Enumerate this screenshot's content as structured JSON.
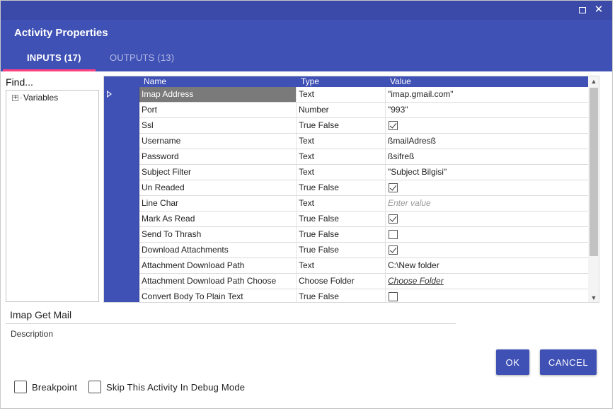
{
  "window": {
    "title": "Activity Properties",
    "maximize_icon": "maximize-icon",
    "close_icon": "close-icon"
  },
  "tabs": [
    {
      "label": "INPUTS (17)",
      "active": true
    },
    {
      "label": "OUTPUTS (13)",
      "active": false
    }
  ],
  "sidebar": {
    "find_label": "Find...",
    "tree": [
      {
        "label": "Variables",
        "expander": "+"
      }
    ]
  },
  "grid": {
    "columns": [
      "Name",
      "Type",
      "Value"
    ],
    "rows": [
      {
        "name": "Imap Address",
        "type": "Text",
        "value": "\"imap.gmail.com\"",
        "kind": "text",
        "active": true
      },
      {
        "name": "Port",
        "type": "Number",
        "value": "\"993\"",
        "kind": "text"
      },
      {
        "name": "Ssl",
        "type": "True False",
        "checked": true,
        "kind": "checkbox"
      },
      {
        "name": "Username",
        "type": "Text",
        "value": "ßmailAdresß",
        "kind": "text"
      },
      {
        "name": "Password",
        "type": "Text",
        "value": "ßsifreß",
        "kind": "text"
      },
      {
        "name": "Subject Filter",
        "type": "Text",
        "value": "\"Subject Bilgisi\"",
        "kind": "text"
      },
      {
        "name": "Un Readed",
        "type": "True False",
        "checked": true,
        "kind": "checkbox"
      },
      {
        "name": "Line Char",
        "type": "Text",
        "value": "Enter value",
        "kind": "placeholder"
      },
      {
        "name": "Mark As Read",
        "type": "True False",
        "checked": true,
        "kind": "checkbox"
      },
      {
        "name": "Send To Thrash",
        "type": "True False",
        "checked": false,
        "kind": "checkbox"
      },
      {
        "name": "Download Attachments",
        "type": "True False",
        "checked": true,
        "kind": "checkbox"
      },
      {
        "name": "Attachment Download Path",
        "type": "Text",
        "value": "C:\\New folder",
        "kind": "text"
      },
      {
        "name": "Attachment Download Path Choose",
        "type": "Choose Folder",
        "value": "Choose Folder",
        "kind": "link"
      },
      {
        "name": "Convert Body To Plain Text",
        "type": "True False",
        "checked": false,
        "kind": "checkbox"
      }
    ]
  },
  "activity": {
    "name": "Imap Get Mail",
    "description_label": "Description"
  },
  "buttons": {
    "ok": "OK",
    "cancel": "CANCEL"
  },
  "options": {
    "breakpoint": "Breakpoint",
    "skip": "Skip This Activity In Debug Mode"
  },
  "colors": {
    "primary": "#3f51b5",
    "titlebar": "#3b4aa8",
    "tab_indicator": "#ff4081",
    "active_cell": "#7a7a7a"
  }
}
